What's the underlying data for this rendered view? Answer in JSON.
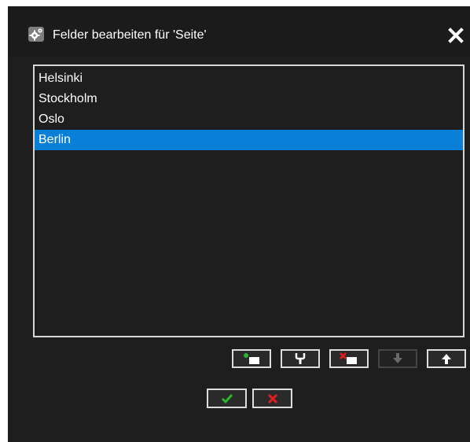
{
  "dialog": {
    "title": "Felder bearbeiten für 'Seite'",
    "title_icon": "gears-icon",
    "close_icon": "close-icon"
  },
  "list": {
    "items": [
      {
        "label": "Helsinki",
        "selected": false
      },
      {
        "label": "Stockholm",
        "selected": false
      },
      {
        "label": "Oslo",
        "selected": false
      },
      {
        "label": "Berlin",
        "selected": true
      }
    ]
  },
  "toolbar": {
    "buttons": [
      {
        "icon": "add-field-icon",
        "enabled": true
      },
      {
        "icon": "edit-field-icon",
        "enabled": true
      },
      {
        "icon": "delete-field-icon",
        "enabled": true
      },
      {
        "icon": "move-down-icon",
        "enabled": false
      },
      {
        "icon": "move-up-icon",
        "enabled": true
      }
    ]
  },
  "actions": {
    "confirm_icon": "checkmark-icon",
    "cancel_icon": "cancel-x-icon"
  },
  "colors": {
    "dialog_background": "#1e1e1e",
    "selection": "#0a7fd8",
    "confirm_green": "#2db52d",
    "cancel_red": "#e01e1e"
  }
}
